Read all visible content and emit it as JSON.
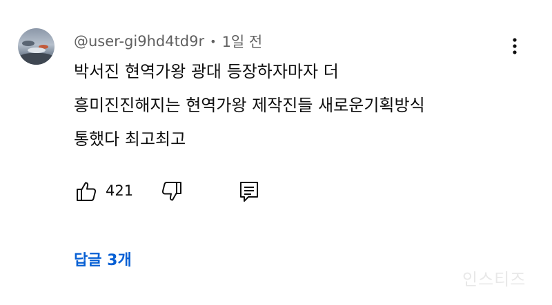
{
  "comment": {
    "author": "@user-gi9hd4td9r",
    "separator": "•",
    "time_ago": "1일 전",
    "text": "박서진 현역가왕 광대 등장하자마자 더\n흥미진진해지는 현역가왕 제작진들 새로운기획방식\n통했다 최고최고",
    "like_count": "421",
    "replies_label": "답글 3개"
  },
  "icons": {
    "menu": "more-vert-icon",
    "like": "thumbs-up-icon",
    "dislike": "thumbs-down-icon",
    "reply": "reply-comment-icon"
  },
  "watermark": "인스티즈",
  "colors": {
    "text": "#0f0f0f",
    "meta": "#606060",
    "link": "#065fd4"
  }
}
